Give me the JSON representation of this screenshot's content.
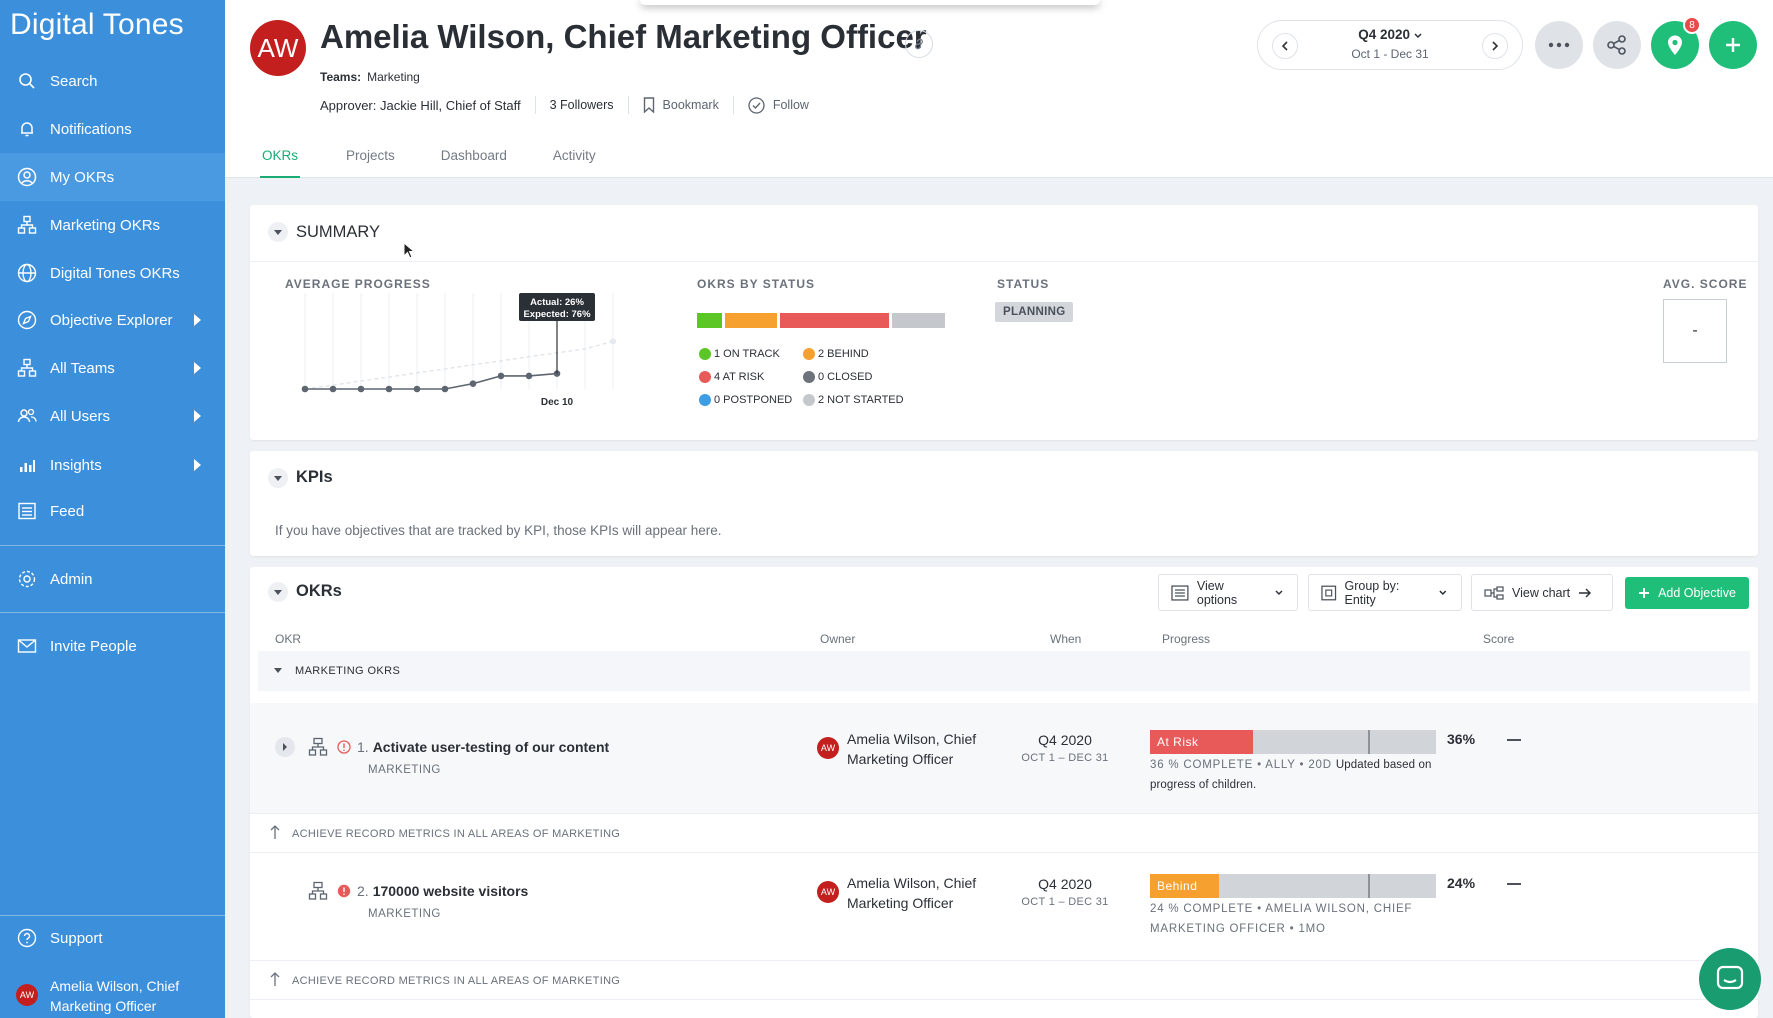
{
  "brand": "Digital Tones",
  "sidebar": {
    "items": [
      {
        "label": "Search",
        "icon": "search-icon"
      },
      {
        "label": "Notifications",
        "icon": "bell-icon"
      },
      {
        "label": "My OKRs",
        "icon": "user-circle-icon"
      },
      {
        "label": "Marketing OKRs",
        "icon": "org-chart-icon"
      },
      {
        "label": "Digital Tones OKRs",
        "icon": "globe-icon"
      },
      {
        "label": "Objective Explorer",
        "icon": "compass-icon"
      },
      {
        "label": "All Teams",
        "icon": "org-chart-icon"
      },
      {
        "label": "All Users",
        "icon": "users-icon"
      },
      {
        "label": "Insights",
        "icon": "bar-chart-icon"
      },
      {
        "label": "Feed",
        "icon": "feed-icon"
      },
      {
        "label": "Admin",
        "icon": "gear-icon"
      },
      {
        "label": "Invite People",
        "icon": "envelope-icon"
      },
      {
        "label": "Support",
        "icon": "help-icon"
      }
    ],
    "user": {
      "initials": "AW",
      "name_line1": "Amelia Wilson, Chief",
      "name_line2": "Marketing Officer"
    }
  },
  "header": {
    "initials": "AW",
    "title": "Amelia Wilson, Chief Marketing Officer",
    "teams_label": "Teams:",
    "teams_value": "Marketing",
    "approver": "Approver: Jackie Hill, Chief of Staff",
    "followers": "3 Followers",
    "bookmark": "Bookmark",
    "follow": "Follow",
    "tabs": [
      "OKRs",
      "Projects",
      "Dashboard",
      "Activity"
    ],
    "period": {
      "title": "Q4 2020",
      "range": "Oct 1 - Dec 31"
    },
    "notification_count": "8"
  },
  "summary": {
    "title": "SUMMARY",
    "avg_progress_label": "AVERAGE PROGRESS",
    "tooltip_actual": "Actual: 26%",
    "tooltip_expected": "Expected: 76%",
    "chart_x_label": "Dec 10",
    "okrs_by_status_label": "OKRS BY STATUS",
    "legend": [
      {
        "label": "1 ON TRACK",
        "color": "#5cc626"
      },
      {
        "label": "2 BEHIND",
        "color": "#f6a030"
      },
      {
        "label": "4 AT RISK",
        "color": "#e85a5a"
      },
      {
        "label": "0 CLOSED",
        "color": "#6d737a"
      },
      {
        "label": "0 POSTPONED",
        "color": "#3d9ee6"
      },
      {
        "label": "2 NOT STARTED",
        "color": "#c4c8cd"
      }
    ],
    "status_label": "STATUS",
    "status_value": "PLANNING",
    "avg_score_label": "AVG. SCORE",
    "avg_score_value": "-"
  },
  "chart_data": {
    "type": "line",
    "title": "AVERAGE PROGRESS",
    "series": [
      {
        "name": "Actual",
        "values": [
          0,
          0,
          0,
          0,
          0,
          0,
          9,
          22,
          22,
          26
        ]
      },
      {
        "name": "Expected",
        "values": [
          0,
          8,
          17,
          25,
          34,
          42,
          51,
          59,
          68,
          76,
          84,
          100
        ]
      }
    ],
    "annotation": "Actual: 26% / Expected: 76%",
    "x_tick": "Dec 10",
    "ylim": [
      0,
      100
    ],
    "grid": true
  },
  "kpis": {
    "title": "KPIs",
    "empty_text": "If you have objectives that are tracked by KPI, those KPIs will appear here."
  },
  "okrs": {
    "title": "OKRs",
    "view_options": "View options",
    "group_by": "Group by: Entity",
    "view_chart": "View chart",
    "add_objective": "Add Objective",
    "columns": {
      "okr": "OKR",
      "owner": "Owner",
      "when": "When",
      "progress": "Progress",
      "score": "Score"
    },
    "group_label": "MARKETING OKRS",
    "parent_text": "ACHIEVE RECORD METRICS IN ALL AREAS OF MARKETING",
    "rows": [
      {
        "number": "1.",
        "title": "Activate user-testing of our content",
        "team": "MARKETING",
        "owner_initials": "AW",
        "owner_line1": "Amelia Wilson, Chief",
        "owner_line2": "Marketing Officer",
        "when_q": "Q4 2020",
        "when_range": "OCT 1 – DEC 31",
        "status": "At Risk",
        "status_color": "#e85a5a",
        "progress": 36,
        "progress_label": "36%",
        "detail": "36 % COMPLETE • ALLY • 20D",
        "detail_plain": "Updated based on progress of children.",
        "score": "—"
      },
      {
        "number": "2.",
        "title": "170000 website visitors",
        "team": "MARKETING",
        "owner_initials": "AW",
        "owner_line1": "Amelia Wilson, Chief",
        "owner_line2": "Marketing Officer",
        "when_q": "Q4 2020",
        "when_range": "OCT 1 – DEC 31",
        "status": "Behind",
        "status_color": "#f6a030",
        "progress": 24,
        "progress_label": "24%",
        "detail": "24 % COMPLETE • AMELIA WILSON, CHIEF MARKETING OFFICER • 1MO",
        "score": "—"
      }
    ]
  }
}
